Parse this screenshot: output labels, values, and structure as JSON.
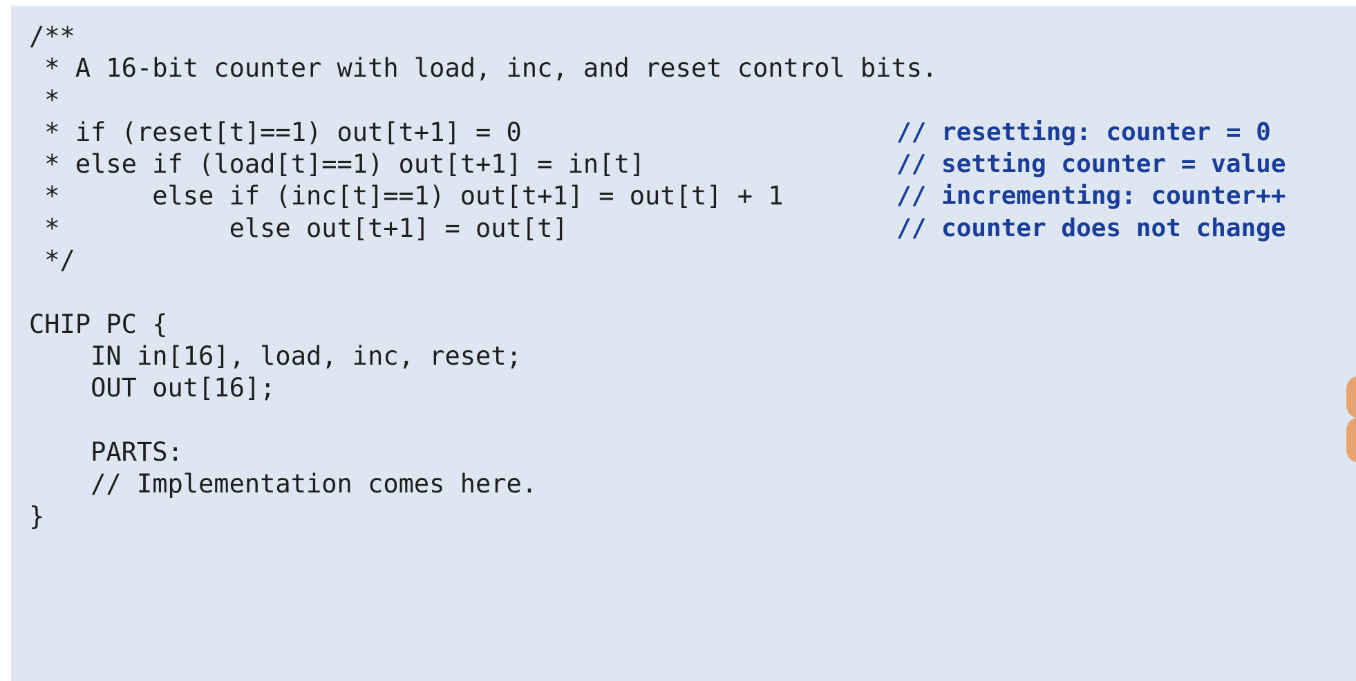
{
  "code": {
    "lines": [
      "/**",
      " * A 16-bit counter with load, inc, and reset control bits.",
      " *",
      " * if (reset[t]==1) out[t+1] = 0",
      " * else if (load[t]==1) out[t+1] = in[t]",
      " *      else if (inc[t]==1) out[t+1] = out[t] + 1",
      " *           else out[t+1] = out[t]",
      " */",
      "",
      "CHIP PC {",
      "    IN in[16], load, inc, reset;",
      "    OUT out[16];",
      "",
      "    PARTS:",
      "    // Implementation comes here.",
      "}"
    ],
    "comments": [
      "// resetting: counter = 0",
      "// setting counter = value",
      "// incrementing: counter++",
      "// counter does not change"
    ]
  },
  "colors": {
    "panel_background": "#dde6f1",
    "code_text": "#1f1f1f",
    "comment_text": "#1a3d9a"
  }
}
